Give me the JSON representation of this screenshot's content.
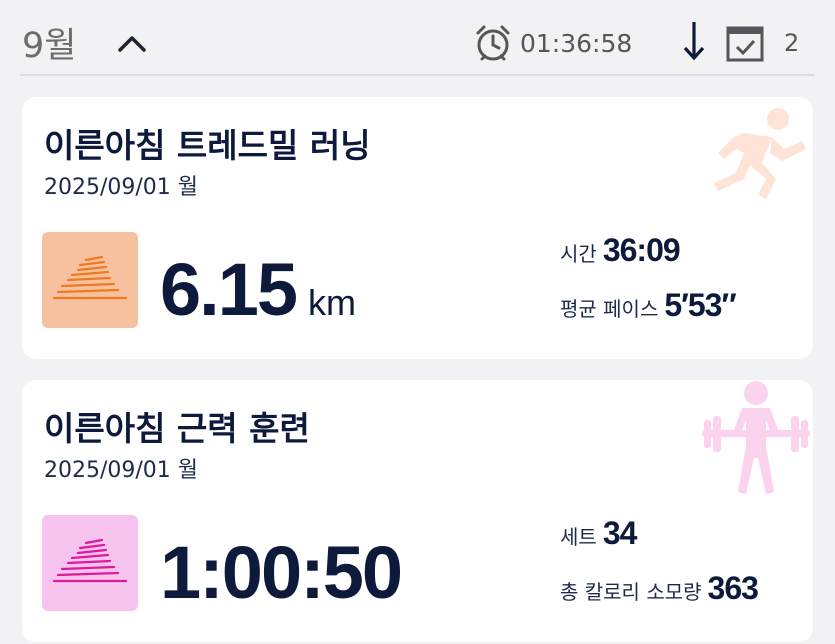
{
  "header": {
    "month": "9월",
    "timer": "01:36:58",
    "count": "2"
  },
  "workouts": [
    {
      "title": "이른아침 트레드밀 러닝",
      "date": "2025/09/01 월",
      "main_value": "6.15",
      "main_unit": "km",
      "stats": [
        {
          "label": "시간",
          "value": "36:09"
        },
        {
          "label": "평균 페이스",
          "value": "5′53″"
        }
      ],
      "icon": "running-icon",
      "tile_color": "#f7c1a0",
      "accent": "#f07a20"
    },
    {
      "title": "이른아침 근력 훈련",
      "date": "2025/09/01 월",
      "main_value": "1:00:50",
      "main_unit": "",
      "stats": [
        {
          "label": "세트",
          "value": "34"
        },
        {
          "label": "총 칼로리 소모량",
          "value": "363"
        }
      ],
      "icon": "weightlifting-icon",
      "tile_color": "#f7c4ef",
      "accent": "#e0189a"
    }
  ]
}
